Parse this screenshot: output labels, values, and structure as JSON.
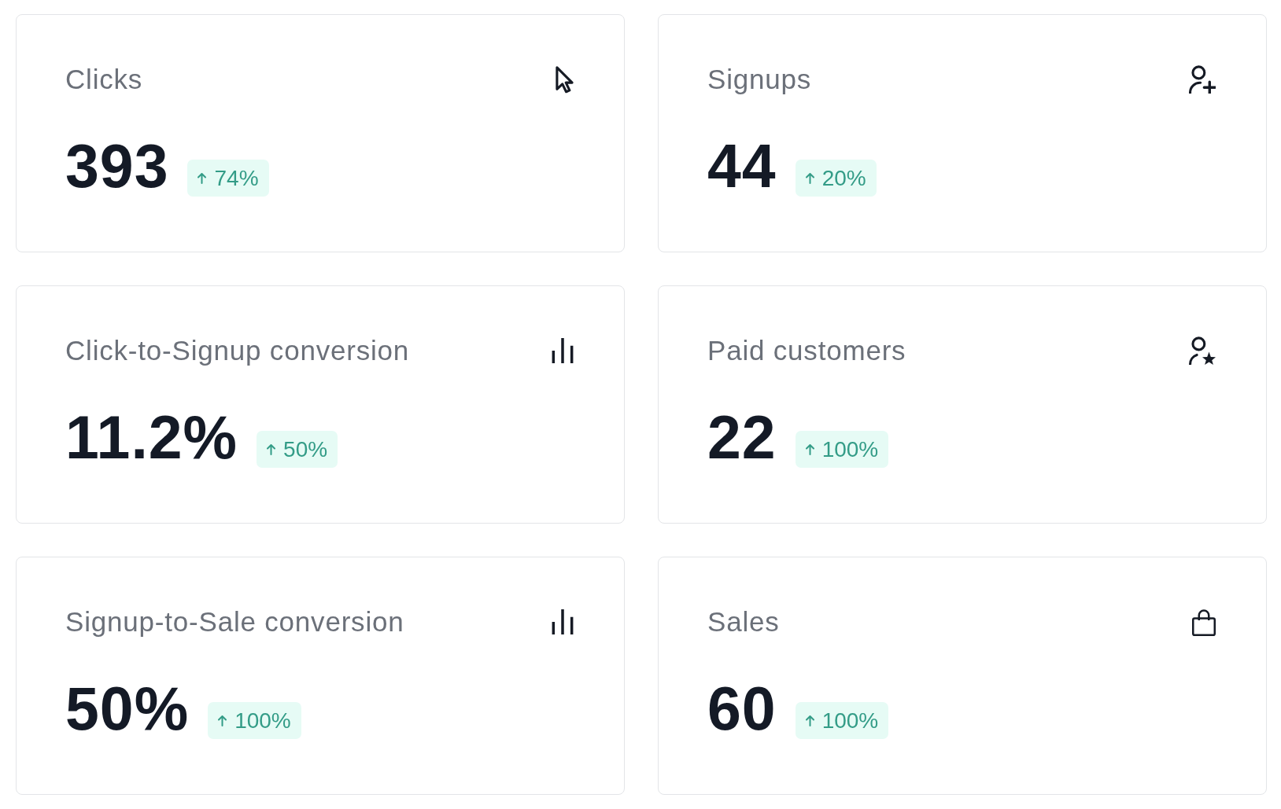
{
  "cards": [
    {
      "title": "Clicks",
      "value": "393",
      "change": "74%",
      "increase": true
    },
    {
      "title": "Signups",
      "value": "44",
      "change": "20%",
      "increase": true
    },
    {
      "title": "Click-to-Signup conversion",
      "value": "11.2%",
      "change": "50%",
      "increase": true
    },
    {
      "title": "Paid customers",
      "value": "22",
      "change": "100%",
      "increase": true
    },
    {
      "title": "Signup-to-Sale conversion",
      "value": "50%",
      "change": "100%",
      "increase": true
    },
    {
      "title": "Sales",
      "value": "60",
      "change": "100%",
      "increase": true
    }
  ]
}
